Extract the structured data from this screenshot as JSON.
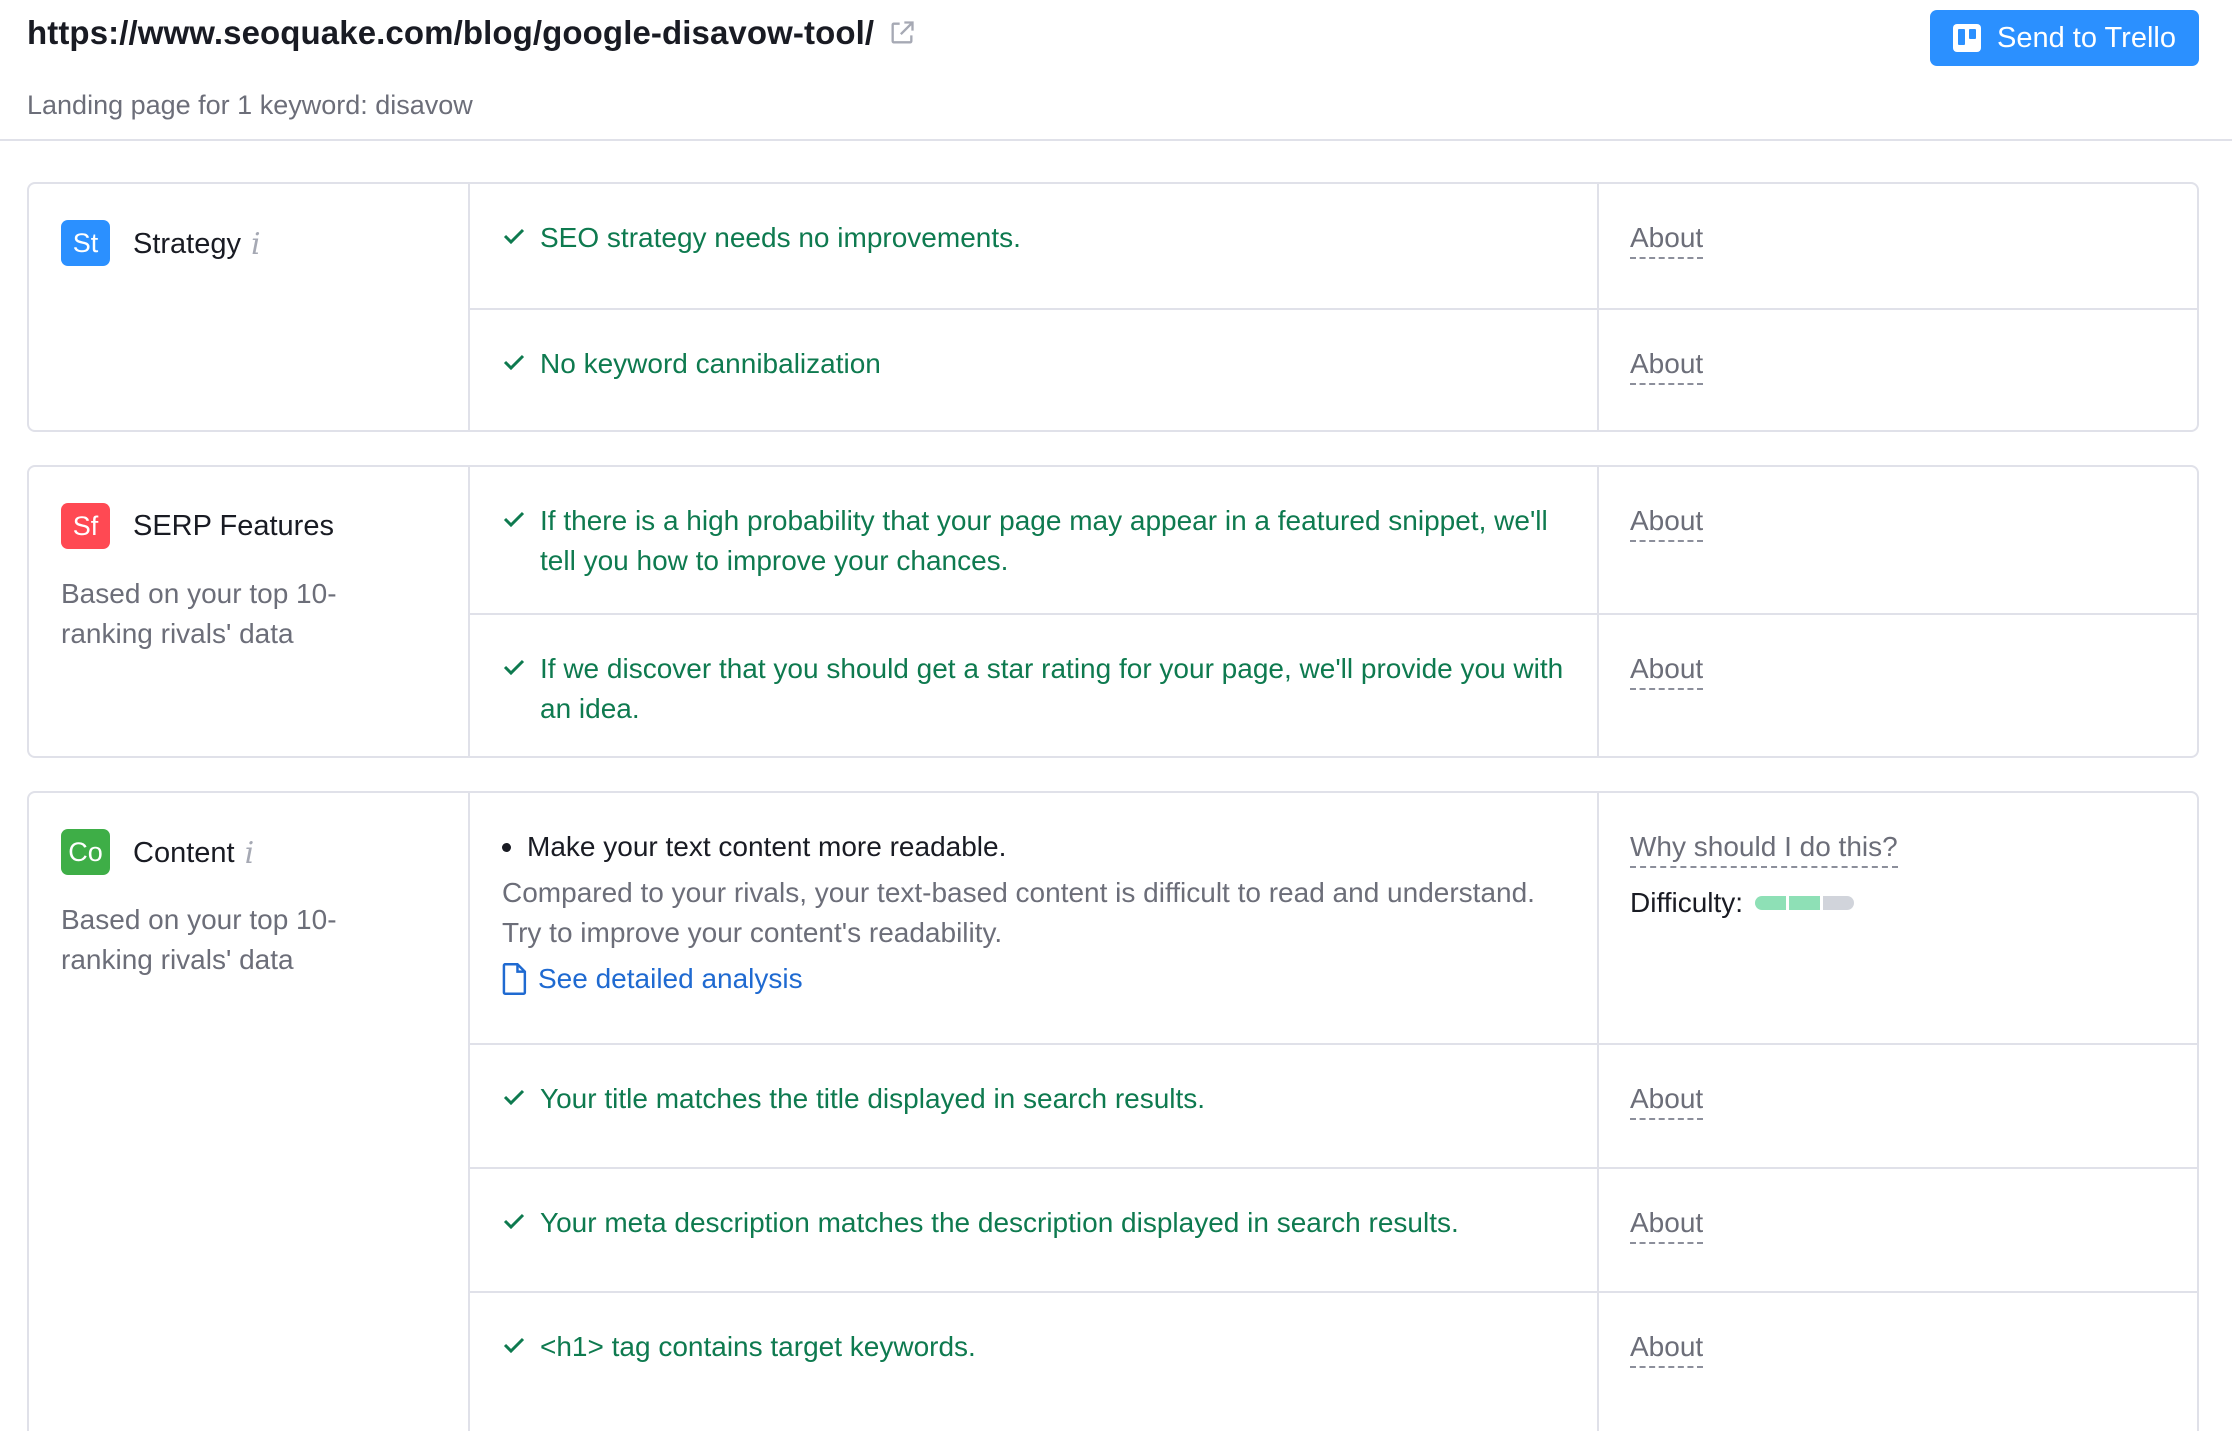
{
  "header": {
    "url": "https://www.seoquake.com/blog/google-disavow-tool/",
    "subtitle": "Landing page for 1 keyword: disavow",
    "trello_button": "Send to Trello"
  },
  "colors": {
    "accent": "#2b90ff",
    "check_green": "#0e7a4f",
    "link_blue": "#1f6ad1",
    "badge_strategy": "#2b90ff",
    "badge_serp": "#ff4953",
    "badge_content": "#3eae47"
  },
  "sections": [
    {
      "badge": "St",
      "name": "Strategy",
      "description": "",
      "items": [
        {
          "status": "ok",
          "text": "SEO strategy needs no improvements.",
          "link": "About"
        },
        {
          "status": "ok",
          "text": "No keyword cannibalization",
          "link": "About"
        }
      ]
    },
    {
      "badge": "Sf",
      "name": "SERP Features",
      "description": "Based on your top 10-ranking rivals' data",
      "items": [
        {
          "status": "ok",
          "text": "If there is a high probability that your page may appear in a featured snippet, we'll tell you how to improve your chances.",
          "link": "About"
        },
        {
          "status": "ok",
          "text": "If we discover that you should get a star rating for your page, we'll provide you with an idea.",
          "link": "About"
        }
      ]
    },
    {
      "badge": "Co",
      "name": "Content",
      "description": "Based on your top 10-ranking rivals' data",
      "items": [
        {
          "status": "todo",
          "text": "Make your text content more readable.",
          "detail": "Compared to your rivals, your text-based content is difficult to read and understand. Try to improve your content's readability.",
          "action": "See detailed analysis",
          "link": "Why should I do this?",
          "difficulty_label": "Difficulty:",
          "difficulty_level": 2,
          "difficulty_max": 3
        },
        {
          "status": "ok",
          "text": "Your title matches the title displayed in search results.",
          "link": "About"
        },
        {
          "status": "ok",
          "text": "Your meta description matches the description displayed in search results.",
          "link": "About"
        },
        {
          "status": "ok",
          "text": "<h1> tag contains target keywords.",
          "link": "About"
        }
      ]
    }
  ],
  "icons": {
    "external_link": "external-link-icon",
    "trello": "trello-icon",
    "check": "check-icon",
    "info": "info-icon",
    "document": "document-icon"
  }
}
